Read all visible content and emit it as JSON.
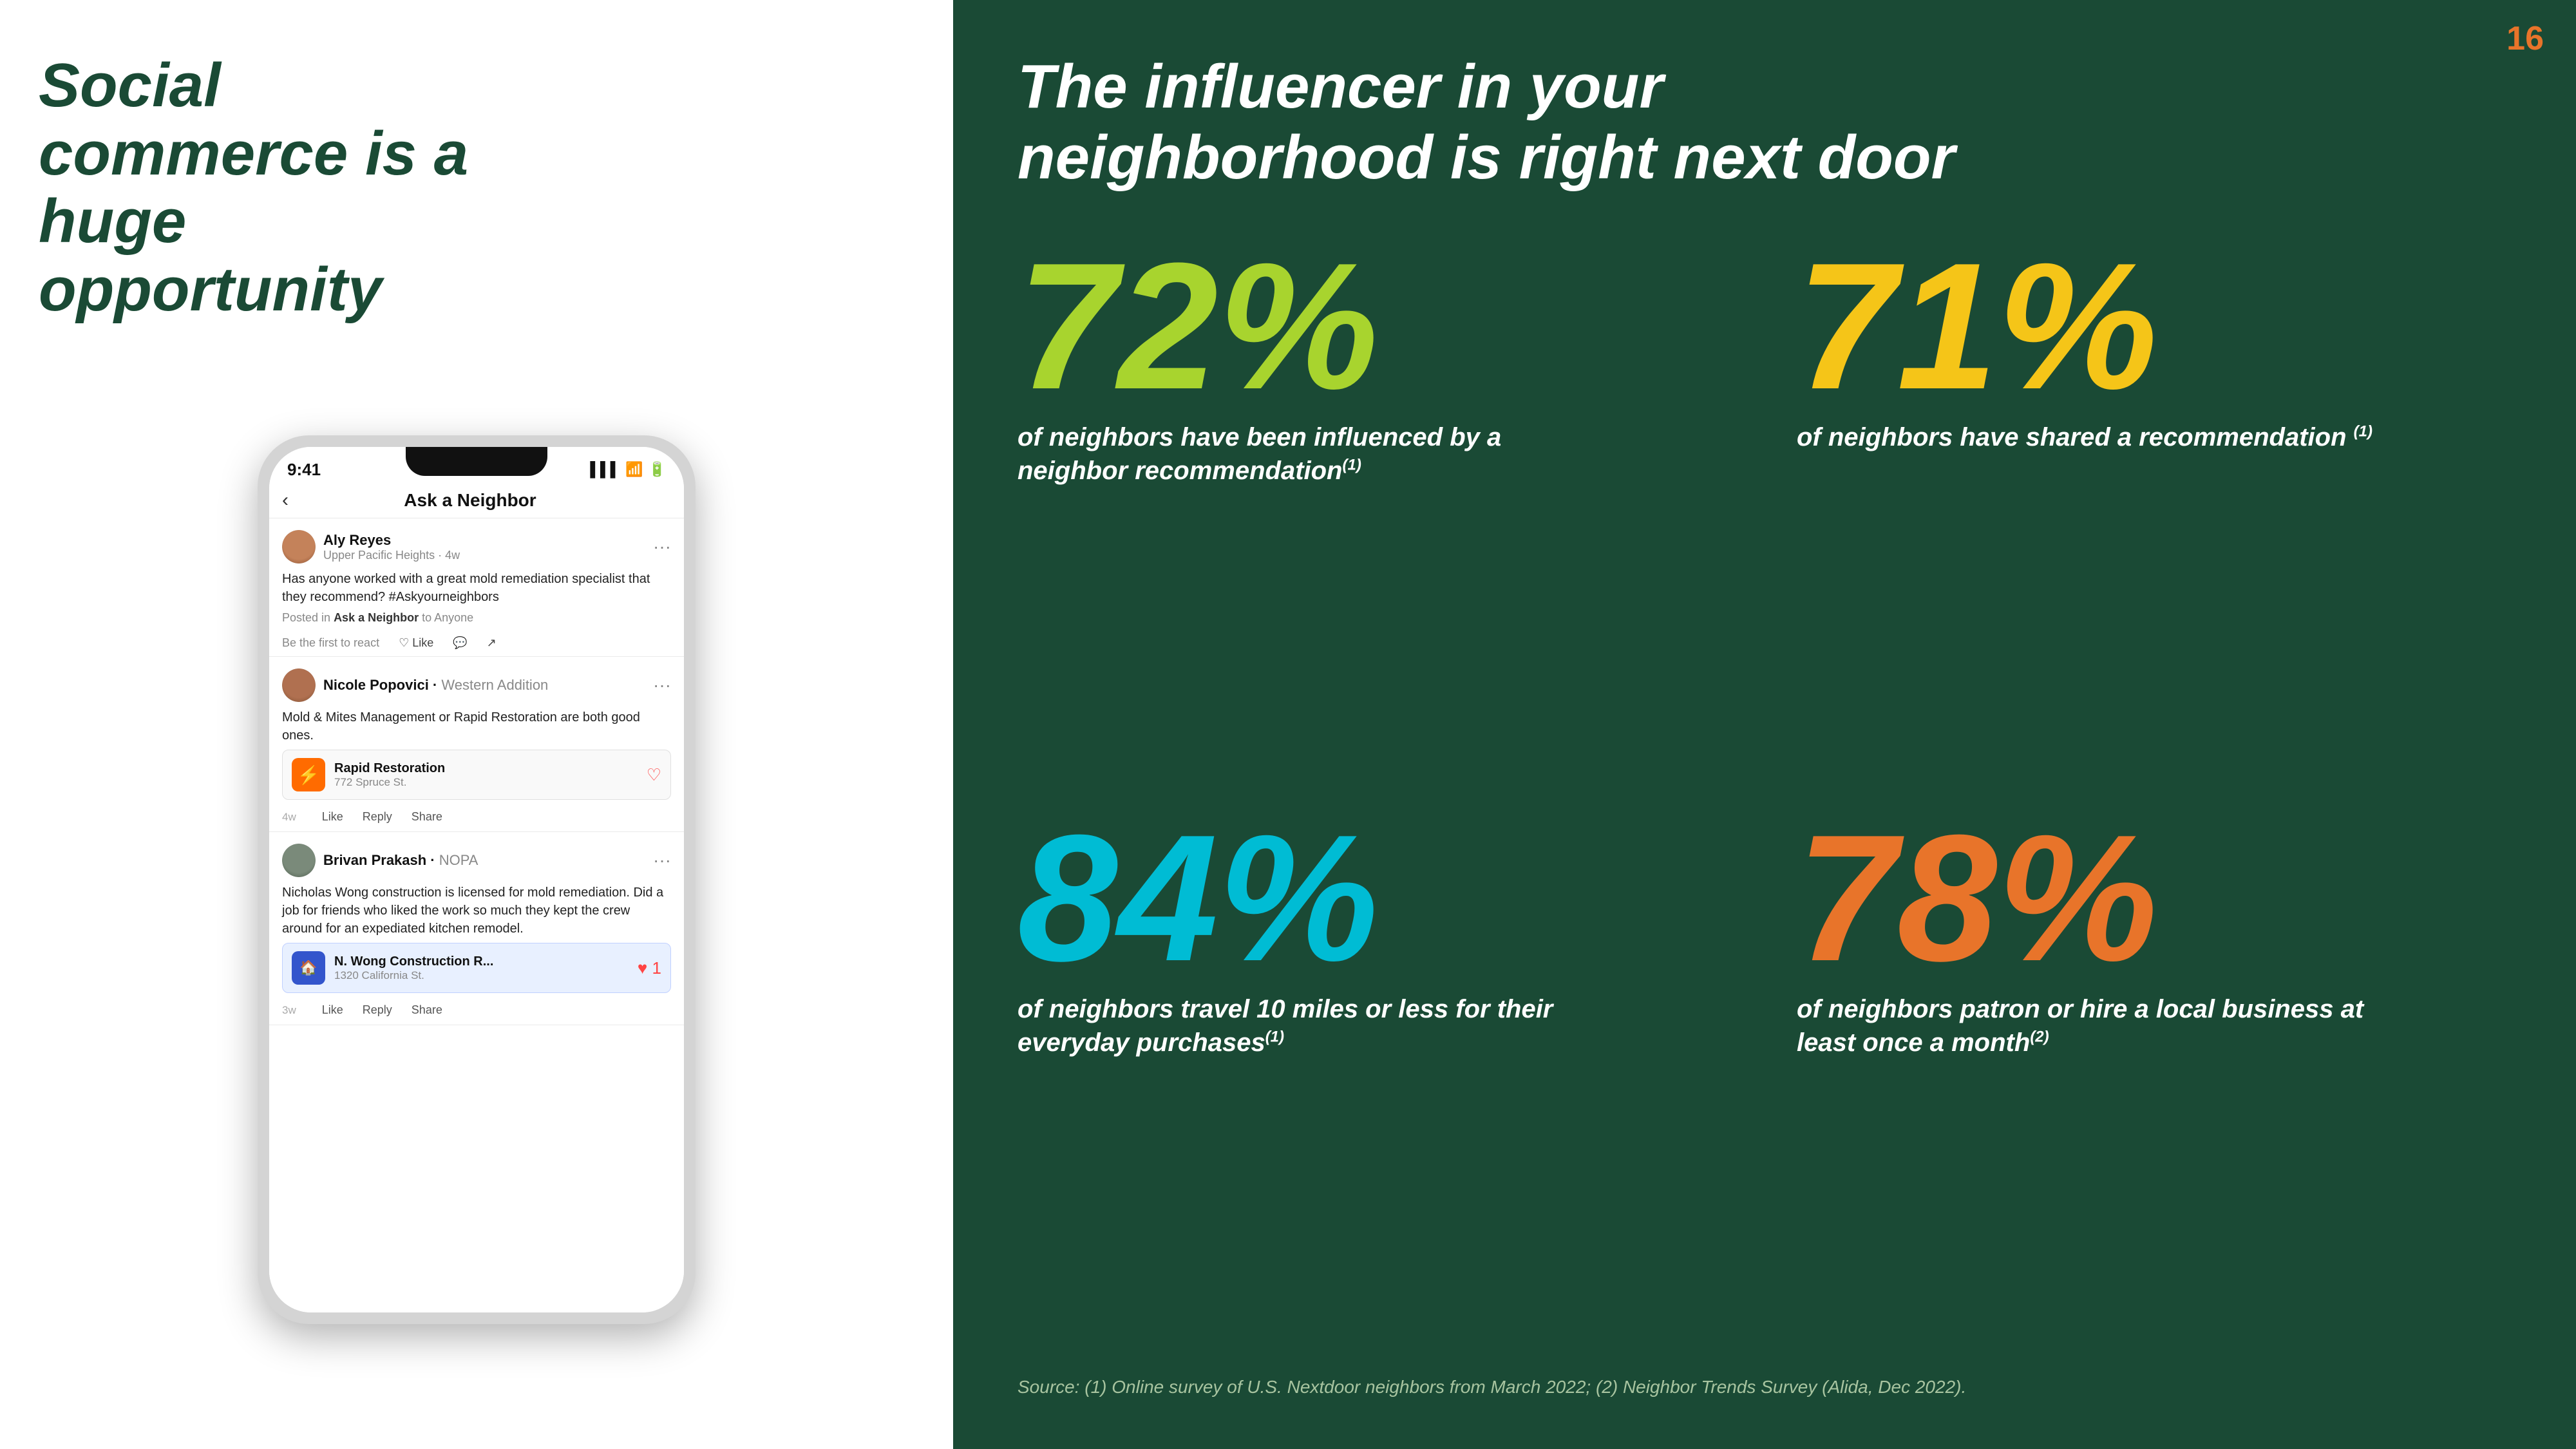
{
  "page": {
    "number": "16"
  },
  "left": {
    "title_line1": "Social commerce is a",
    "title_line2": "huge opportunity"
  },
  "phone": {
    "status_time": "9:41",
    "status_icons": "▲ ▲ 🔋",
    "nav_title": "Ask a Neighbor",
    "posts": [
      {
        "author": "Aly Reyes",
        "location": "Upper Pacific Heights · 4w",
        "body": "Has anyone worked with a great mold remediation specialist that they recommend?\n#Askyourneighbors",
        "sub": "Posted in Ask a Neighbor to Anyone",
        "reactions": [
          "Like",
          "Comment",
          "Share"
        ],
        "be_first": "Be the first to react"
      },
      {
        "author": "Nicole Popovici",
        "location": "Western Addition",
        "body": "Mold & Mites Management or Rapid Restoration are both good ones.",
        "business": {
          "name": "Rapid Restoration",
          "address": "772 Spruce St.",
          "icon": "⚡"
        },
        "time": "4w",
        "actions": [
          "Like",
          "Reply",
          "Share"
        ]
      },
      {
        "author": "Brivan Prakash",
        "location": "NOPA",
        "body": "Nicholas Wong construction is licensed for mold remediation. Did a job for friends who liked the work so much they kept the crew around for an expediated kitchen remodel.",
        "business": {
          "name": "N. Wong Construction R...",
          "address": "1320 California St.",
          "icon": "🏠",
          "heart": "1"
        },
        "time": "3w",
        "actions": [
          "Like",
          "Reply",
          "Share"
        ]
      }
    ]
  },
  "right": {
    "title_line1": "The influencer in your",
    "title_line2": "neighborhood is right next door",
    "stats": [
      {
        "number": "72%",
        "description": "of neighbors have been influenced by a neighbor recommendation",
        "sup": "(1)",
        "color_class": "stat-72"
      },
      {
        "number": "71%",
        "description": "of neighbors have shared a recommendation",
        "sup": "(1)",
        "color_class": "stat-71"
      },
      {
        "number": "84%",
        "description": "of neighbors travel 10 miles or less for their everyday purchases",
        "sup": "(1)",
        "color_class": "stat-84"
      },
      {
        "number": "78%",
        "description": "of neighbors patron or hire a local business at least once a month",
        "sup": "(2)",
        "color_class": "stat-78"
      }
    ],
    "source": "Source: (1) Online survey of U.S. Nextdoor neighbors from March 2022; (2) Neighbor Trends Survey (Alida, Dec 2022)."
  }
}
